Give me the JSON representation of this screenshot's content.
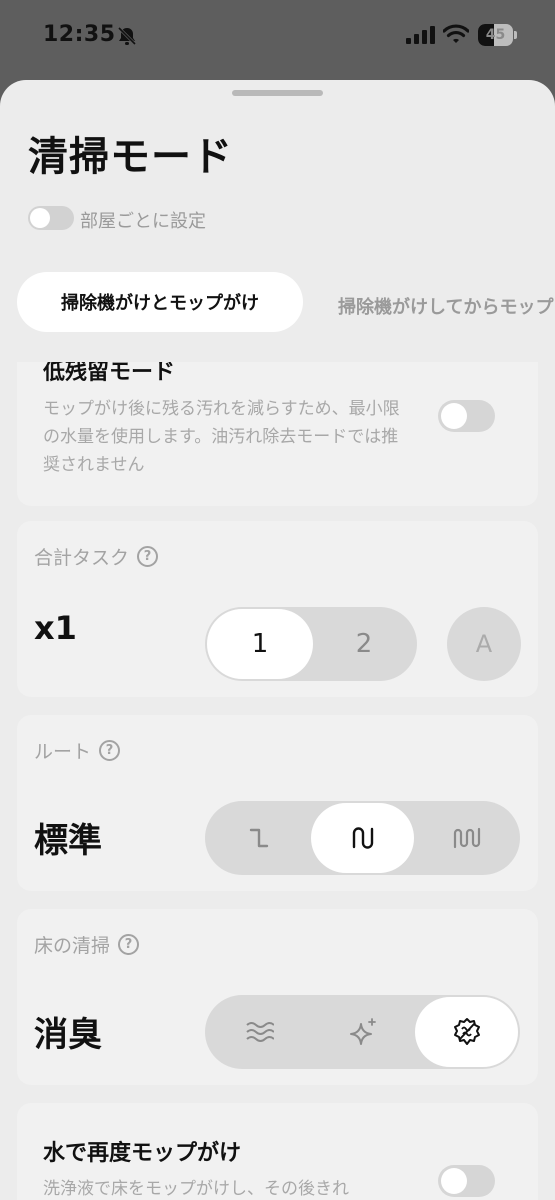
{
  "status": {
    "time": "12:35",
    "battery": "45",
    "battery_level": 0.45
  },
  "header": {
    "title": "清掃モード",
    "room_toggle_label": "部屋ごとに設定",
    "room_toggle_on": false
  },
  "tabs": [
    {
      "label": "掃除機がけとモップがけ",
      "selected": true
    },
    {
      "label": "掃除機がけしてからモップ",
      "selected": false
    }
  ],
  "low_residue": {
    "title": "低残留モード",
    "description": "モップがけ後に残る汚れを減らすため、最小限の水量を使用します。油汚れ除去モードでは推奨されません",
    "enabled": false
  },
  "total_tasks": {
    "label": "合計タスク",
    "value": "x1",
    "options": [
      "1",
      "2"
    ],
    "selected": "1",
    "auto_label": "A"
  },
  "route": {
    "label": "ルート",
    "value": "標準",
    "options": [
      "quick-route-icon",
      "standard-route-icon",
      "deep-route-icon"
    ],
    "selected_index": 1
  },
  "floor_cleaning": {
    "label": "床の清掃",
    "value": "消臭",
    "options": [
      "wave-icon",
      "sparkle-icon",
      "deodorize-icon"
    ],
    "selected_index": 2
  },
  "re_mop": {
    "title": "水で再度モップがけ",
    "description": "洗浄液で床をモップがけし、その後きれ",
    "enabled": false
  },
  "help_glyph": "?"
}
